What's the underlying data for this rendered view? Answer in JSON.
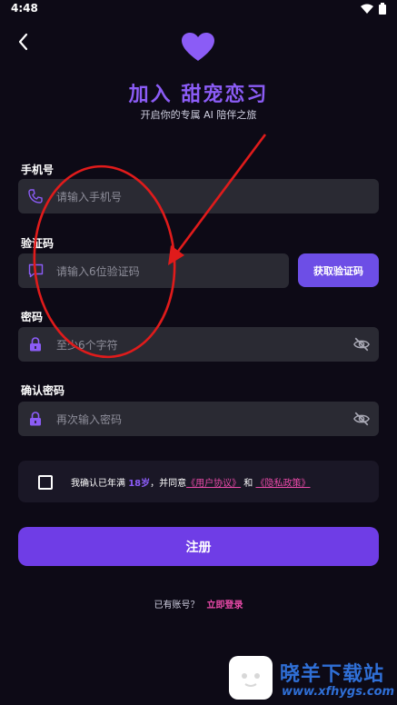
{
  "status_bar": {
    "time": "4:48"
  },
  "header": {
    "title": "加入 甜宠恋习",
    "subtitle": "开启你的专属 AI 陪伴之旅"
  },
  "form": {
    "phone": {
      "label": "手机号",
      "placeholder": "请输入手机号"
    },
    "code": {
      "label": "验证码",
      "placeholder": "请输入6位验证码",
      "button": "获取验证码"
    },
    "password": {
      "label": "密码",
      "placeholder": "至少6个字符"
    },
    "confirm": {
      "label": "确认密码",
      "placeholder": "再次输入密码"
    }
  },
  "agreement": {
    "prefix": "我确认已年满",
    "age": "18岁",
    "middle": "，并同意",
    "terms": "《用户协议》",
    "and": "和",
    "privacy": "《隐私政策》"
  },
  "register_button": "注册",
  "footer": {
    "has_account": "已有账号？",
    "login_link": "立即登录"
  },
  "watermark": {
    "name": "晓羊下载站",
    "url": "www.xfhygs.com"
  },
  "colors": {
    "accent": "#8b5cf6",
    "button": "#6f3de6",
    "link": "#e84aa8",
    "annotation": "#e01b1b"
  }
}
